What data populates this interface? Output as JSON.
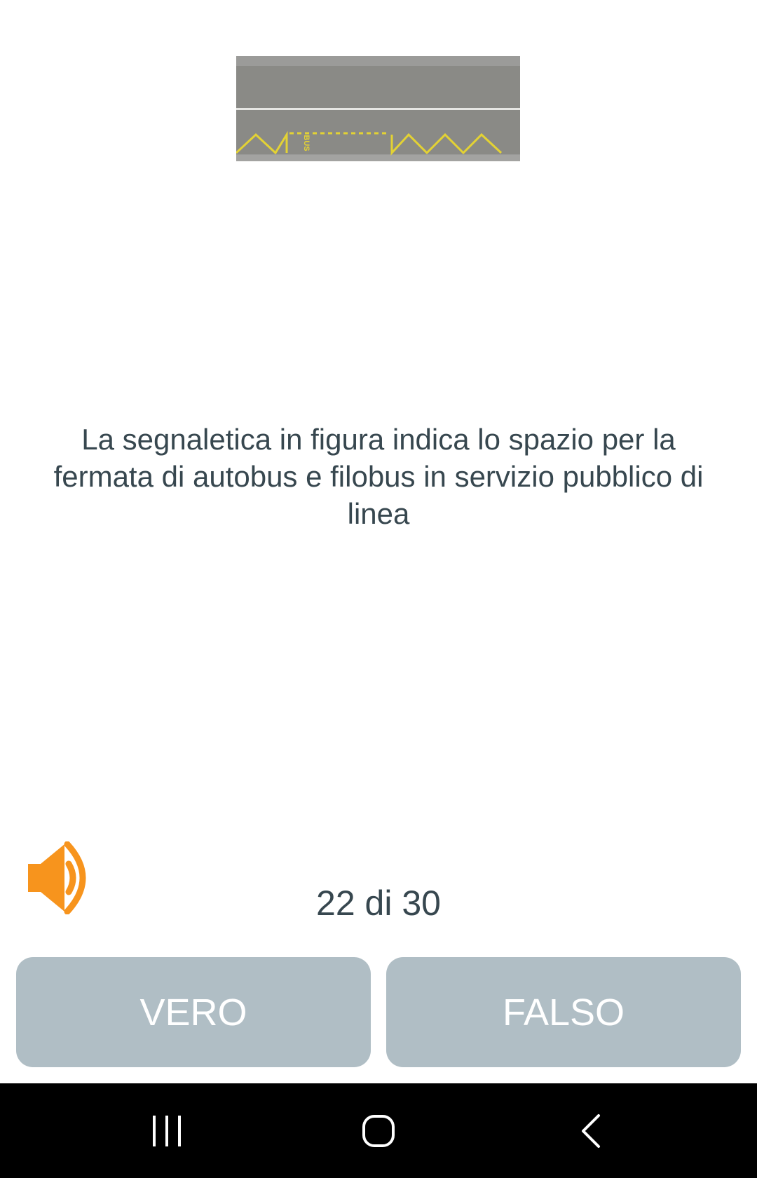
{
  "question": {
    "text": "La segnaletica in figura indica lo spazio per la fermata di autobus e filobus in servizio pubblico di linea"
  },
  "image": {
    "marking_text": "BUS"
  },
  "progress": {
    "label": "22 di 30",
    "current": 22,
    "total": 30
  },
  "answers": {
    "true_label": "VERO",
    "false_label": "FALSO"
  },
  "colors": {
    "accent": "#f7941d",
    "button_bg": "#b0bec5",
    "text": "#37474f",
    "road": "#8a8a86",
    "marking": "#e3d234"
  },
  "icons": {
    "speaker": "speaker-icon",
    "recents": "recents-icon",
    "home": "home-icon",
    "back": "back-icon"
  }
}
